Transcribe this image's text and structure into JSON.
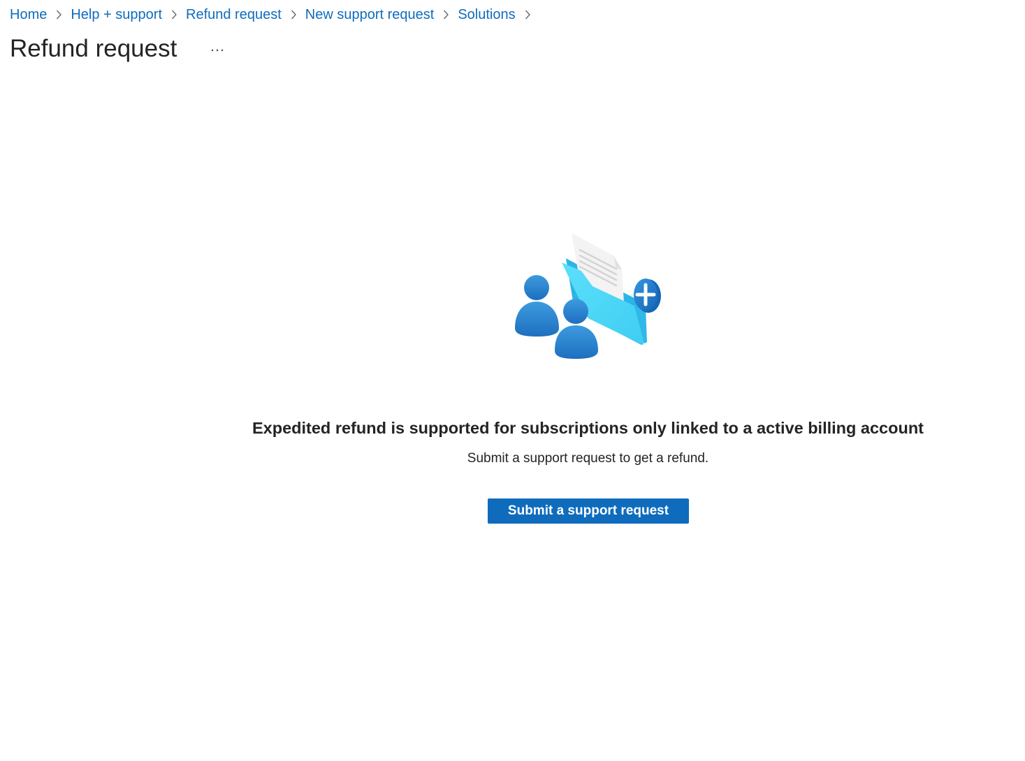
{
  "breadcrumb": {
    "items": [
      {
        "label": "Home"
      },
      {
        "label": "Help + support"
      },
      {
        "label": "Refund request"
      },
      {
        "label": "New support request"
      },
      {
        "label": "Solutions"
      }
    ]
  },
  "header": {
    "title": "Refund request",
    "more_label": "...",
    "more_icon": "ellipsis-icon"
  },
  "empty_state": {
    "illustration_icon": "support-folder-people-icon",
    "heading": "Expedited refund is supported for subscriptions only linked to a active billing account",
    "subtext": "Submit a support request to get a refund.",
    "button_label": "Submit a support request"
  },
  "colors": {
    "link": "#0f6cbd",
    "primary_button": "#0f6cbd",
    "text": "#242424"
  }
}
